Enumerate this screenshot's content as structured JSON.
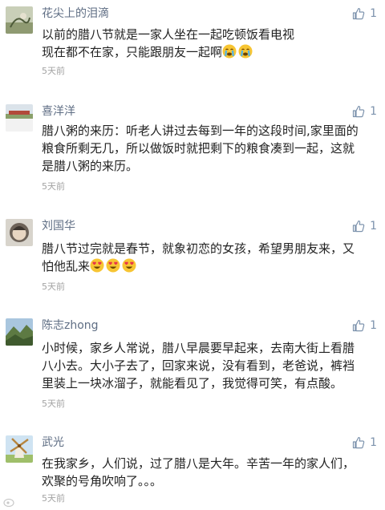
{
  "comments": [
    {
      "username": "花尖上的泪滴",
      "avatar_icon": "avatar-plant-icon",
      "like_count": "1",
      "lines": [
        "以前的腊八节就是一家人坐在一起吃顿饭看电视",
        "现在都不在家，只能跟朋友一起啊"
      ],
      "emoji": [
        "crying-face-icon",
        "crying-face-icon"
      ],
      "time": "5天前"
    },
    {
      "username": "喜洋洋",
      "avatar_icon": "avatar-landscape-icon",
      "like_count": "1",
      "lines": [
        "腊八粥的来历：听老人讲过去每到一年的这段时间,家里面的",
        "粮食所剩无几，所以做饭时就把剩下的粮食凑到一起，这就",
        "是腊八粥的来历。"
      ],
      "time": "5天前"
    },
    {
      "username": "刘国华",
      "avatar_icon": "avatar-portrait-icon",
      "like_count": "1",
      "lines": [
        "腊八节过完就是春节，就象初恋的女孩，希望男朋友来，又",
        "怕他乱来"
      ],
      "emoji": [
        "heart-eyes-icon",
        "heart-eyes-icon",
        "heart-eyes-icon"
      ],
      "time": "5天前"
    },
    {
      "username": "陈志zhong",
      "avatar_icon": "avatar-mountain-icon",
      "like_count": "1",
      "lines": [
        "小时候，家乡人常说，腊八早晨要早起来，去南大街上看腊",
        "八小去。大小子去了，回家来说，没有看到，老爸说，裤裆",
        "里装上一块冰溜子，就能看见了，我觉得可笑，有点酸。"
      ],
      "time": "5天前"
    },
    {
      "username": "武光",
      "avatar_icon": "avatar-windmill-icon",
      "like_count": "1",
      "lines": [
        "在我家乡，人们说，过了腊八是大年。辛苦一年的家人们，",
        "欢聚的号角吹响了。。。"
      ],
      "time": "5天前"
    }
  ],
  "colors": {
    "username": "#5f6e84",
    "like": "#7d93ad",
    "text": "#222222",
    "time": "#a3a3a3"
  }
}
